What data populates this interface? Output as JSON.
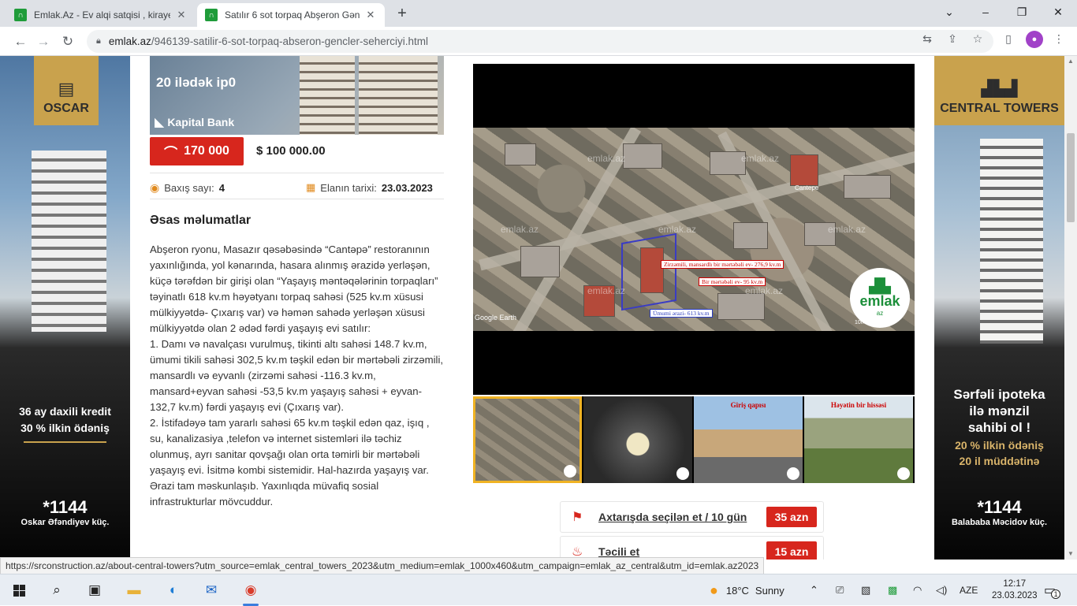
{
  "browser": {
    "tabs": [
      {
        "title": "Emlak.Az - Ev alqi satqisi , kiraye",
        "favicon": "emlak-favicon"
      },
      {
        "title": "Satılır 6 sot torpaq Abşeron Gənc",
        "favicon": "emlak-favicon"
      }
    ],
    "new_tab": "+",
    "window_controls": {
      "minimize": "–",
      "maximize": "❐",
      "close": "✕",
      "tab_search": "⌄"
    },
    "url_host": "emlak.az",
    "url_path": "/946139-satilir-6-sot-torpaq-abseron-gencler-seherciyi.html"
  },
  "left_ad": {
    "brand": "OSCAR",
    "line1": "36 ay daxili kredit",
    "line2": "30 % ilkin ödəniş",
    "phone": "*1144",
    "address": "Oskar Əfəndiyev küç."
  },
  "right_ad": {
    "brand": "CENTRAL TOWERS",
    "line1": "Sərfəli ipoteka",
    "line2": "ilə mənzil",
    "line3": "sahibi ol !",
    "line4": "20 % ilkin ödəniş",
    "line5": "20 il müddətinə",
    "phone": "*1144",
    "address": "Balababa Məcidov küç."
  },
  "banner": {
    "headline": "20 ilədək ip0",
    "bank": "Kapital Bank"
  },
  "listing": {
    "price_azn": "170 000",
    "price_usd": "$ 100 000.00",
    "views_label": "Baxış sayı:",
    "views": "4",
    "date_label": "Elanın tarixi:",
    "date": "23.03.2023",
    "section_title": "Əsas məlumatlar",
    "description": [
      "Abşeron ryonu, Masazır qəsəbəsində “Cantəpə” restoranının yaxınlığında, yol kənarında, hasara alınmış ərazidə yerləşən, küçə tərəfdən bir girişi olan “Yaşayış məntəqələrinin torpaqları” təyinatlı 618 kv.m həyətyanı torpaq sahəsi (525 kv.m xüsusi mülkiyyətdə- Çıxarış var) və həmən sahədə yerləşən xüsusi mülkiyyətdə olan 2 ədəd fərdi yaşayış evi satılır:",
      "1. Damı və navalçası vurulmuş, tikinti altı sahəsi 148.7 kv.m, ümumi tikili sahəsi 302,5 kv.m təşkil edən bir mərtəbəli zirzəmili, mansardlı və eyvanlı (zirzəmi sahəsi -116.3 kv.m, mansard+eyvan sahəsi -53,5 kv.m yaşayış sahəsi + eyvan-132,7 kv.m) fərdi yaşayış evi (Çıxarış var).",
      "2. İstifadəyə tam yararlı sahəsi 65 kv.m təşkil edən qaz, işıq , su, kanalizasiya ,telefon və internet sistemləri ilə təchiz olunmuş, ayrı sanitar qovşağı olan orta təmirli bir mərtəbəli yaşayış evi. İsitmə kombi sistemidir. Hal-hazırda yaşayış var.",
      "Ərazi tam məskunlaşıb. Yaxınlıqda müvafiq sosial infrastrukturlar mövcuddur."
    ]
  },
  "photo": {
    "annotations": {
      "a1": "Zirzəmili, mansardlı bir mərtəbəli ev- 276,9 kv.m",
      "a2": "Bir mərtəbəli ev- 95 kv.m",
      "a3": "Ümumi ərazi- 613 kv.m"
    },
    "map_labels": {
      "place": "Cantepe",
      "source": "Google Earth",
      "scale": "10m"
    },
    "watermark": "emlak.az",
    "logo": "emlak",
    "logo_sub": "az",
    "thumb_captions": [
      "",
      "",
      "Giriş qapısı",
      "Həyətin bir hissəsi"
    ]
  },
  "promos": [
    {
      "label": "Axtarışda seçilən et / 10 gün",
      "price": "35 azn",
      "icon": "flag-icon"
    },
    {
      "label": "Təcili et",
      "price": "15 azn",
      "icon": "siren-icon"
    }
  ],
  "status_url": "https://srconstruction.az/about-central-towers?utm_source=emlak_central_towers_2023&utm_medium=emlak_1000x460&utm_campaign=emlak_az_central&utm_id=emlak.az2023",
  "taskbar": {
    "weather_temp": "18°C",
    "weather_text": "Sunny",
    "language": "AZE",
    "time": "12:17",
    "date": "23.03.2023",
    "notifications": "1"
  },
  "colors": {
    "accent_red": "#d7261d",
    "brand_green": "#1f9c3a",
    "gold": "#c9a24d"
  }
}
